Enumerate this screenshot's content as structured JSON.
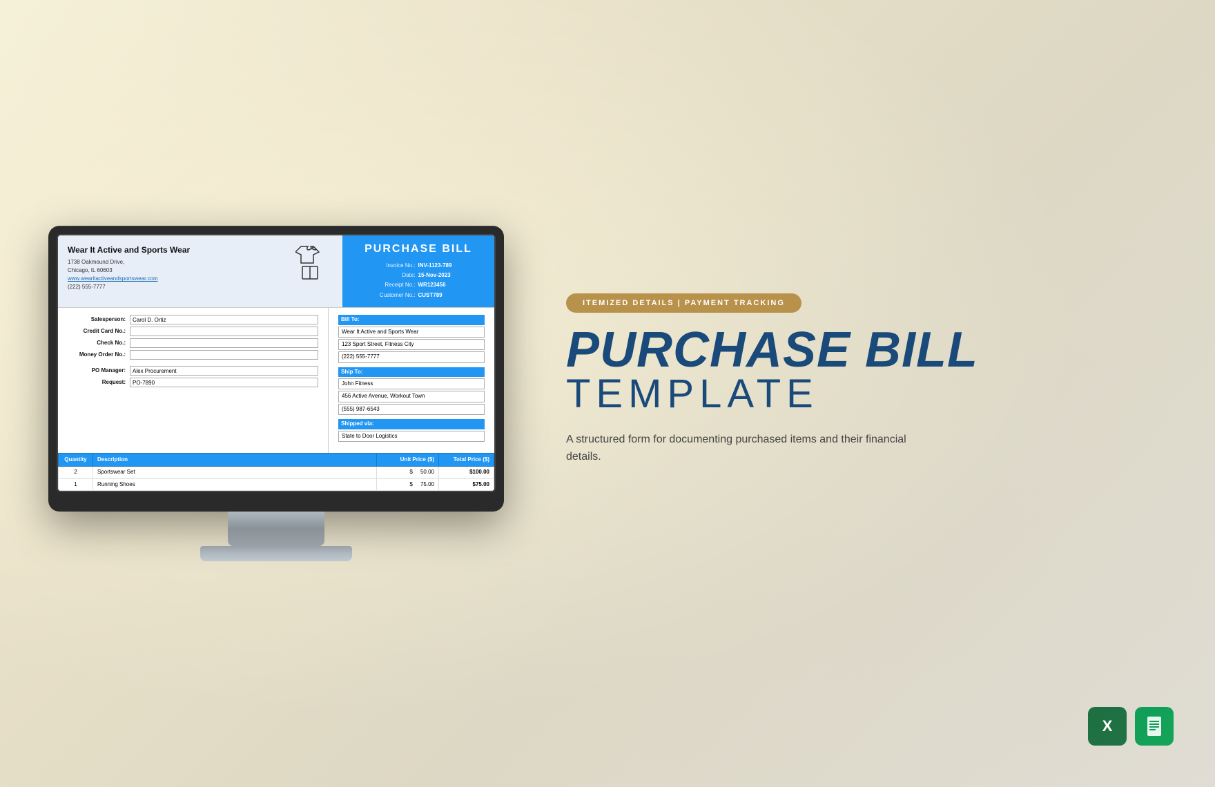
{
  "monitor": {
    "invoice": {
      "company": {
        "name": "Wear It Active and Sports Wear",
        "address_line1": "1738 Oakmound Drive,",
        "address_line2": "Chicago, IL 60603",
        "website": "www.wearitactiveandsportswear.com",
        "phone": "(222) 555-7777"
      },
      "header": {
        "title": "PURCHASE  BILL",
        "invoice_no_label": "Invoice No.:",
        "invoice_no_value": "INV-1123-789",
        "date_label": "Date:",
        "date_value": "15-Nov-2023",
        "receipt_no_label": "Receipt No.:",
        "receipt_no_value": "WR123456",
        "customer_no_label": "Customer No.:",
        "customer_no_value": "CUST789"
      },
      "form_fields": {
        "salesperson_label": "Salesperson:",
        "salesperson_value": "Carol D. Ortiz",
        "credit_card_label": "Credit Card No.:",
        "credit_card_value": "",
        "check_label": "Check No.:",
        "check_value": "",
        "money_order_label": "Money Order No.:",
        "money_order_value": "",
        "po_manager_label": "PO Manager:",
        "po_manager_value": "Alex Procurement",
        "request_label": "Request:",
        "request_value": "PO-7890"
      },
      "bill_to": {
        "header": "Bill To:",
        "line1": "Wear It Active and Sports Wear",
        "line2": "123 Sport Street, Fitness City",
        "line3": "(222) 555-7777"
      },
      "ship_to": {
        "header": "Ship To:",
        "line1": "John Fitness",
        "line2": "456 Active Avenue, Workout Town",
        "line3": "(555) 987-6543"
      },
      "shipped_via": {
        "header": "Shipped via:",
        "value": "State to Door Logistics"
      },
      "table": {
        "headers": [
          "Quantity",
          "Description",
          "Unit Price ($)",
          "Total  Price ($)"
        ],
        "rows": [
          {
            "qty": "2",
            "desc": "Sportswear Set",
            "unit": "$ 50.00",
            "total": "$100.00"
          },
          {
            "qty": "1",
            "desc": "Running Shoes",
            "unit": "$ 75.00",
            "total": "$75.00"
          }
        ]
      }
    }
  },
  "sidebar": {
    "badge_text": "ITEMIZED DETAILS  |  PAYMENT TRACKING",
    "headline1": "PURCHASE BILL",
    "headline2": "TEMPLATE",
    "description": "A structured form for documenting purchased items and their financial details."
  },
  "app_icons": {
    "excel_letter": "X",
    "sheets_letter": ""
  }
}
